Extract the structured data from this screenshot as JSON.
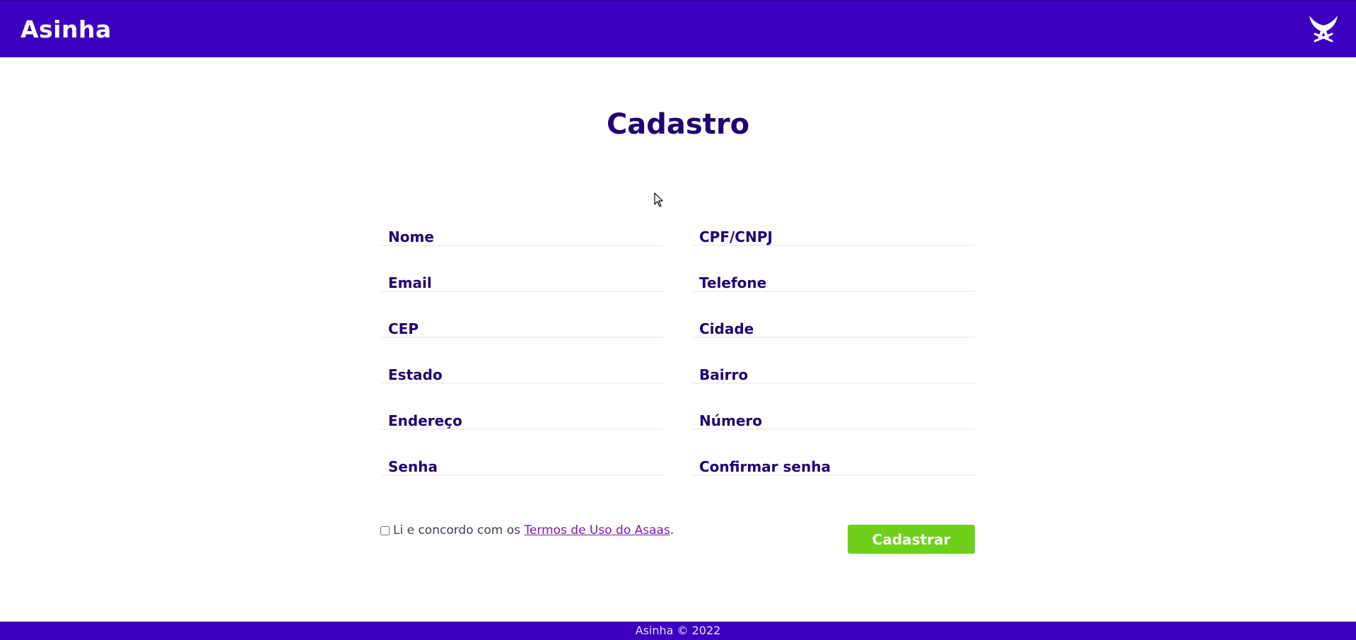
{
  "header": {
    "brand": "Asinha",
    "logo_icon": "winged-swords-icon",
    "bg_color": "#3d00c0"
  },
  "main": {
    "title": "Cadastro",
    "fields": {
      "nome": {
        "label": "Nome",
        "value": ""
      },
      "cpf_cnpj": {
        "label": "CPF/CNPJ",
        "value": ""
      },
      "email": {
        "label": "Email",
        "value": ""
      },
      "telefone": {
        "label": "Telefone",
        "value": ""
      },
      "cep": {
        "label": "CEP",
        "value": ""
      },
      "cidade": {
        "label": "Cidade",
        "value": ""
      },
      "estado": {
        "label": "Estado",
        "value": ""
      },
      "bairro": {
        "label": "Bairro",
        "value": ""
      },
      "endereco": {
        "label": "Endereço",
        "value": ""
      },
      "numero": {
        "label": "Número",
        "value": ""
      },
      "senha": {
        "label": "Senha",
        "value": ""
      },
      "confirmar_senha": {
        "label": "Confirmar senha",
        "value": ""
      }
    },
    "terms": {
      "prefix": "Li e concordo com os",
      "link": "Termos de Uso do Asaas",
      "suffix": ".",
      "checked": false
    },
    "submit_label": "Cadastrar",
    "submit_color": "#6fd01c"
  },
  "footer": {
    "text": "Asinha © 2022"
  }
}
